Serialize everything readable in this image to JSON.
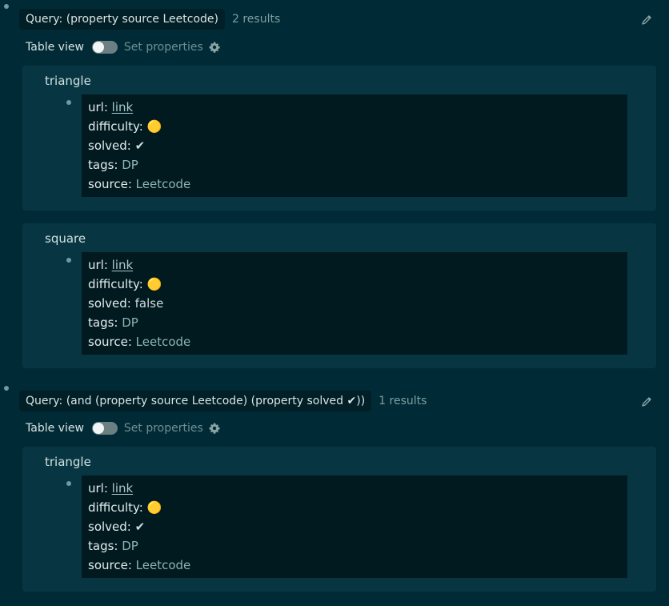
{
  "queries": [
    {
      "label": "Query: (property source Leetcode)",
      "count": "2 results",
      "table_view_label": "Table view",
      "set_props_label": "Set properties",
      "results": [
        {
          "title": "triangle",
          "props": [
            {
              "key": "url",
              "sep": ": ",
              "value": "link",
              "type": "link"
            },
            {
              "key": "difficulty",
              "sep": ": ",
              "value": "🟡",
              "type": "plain"
            },
            {
              "key": "solved",
              "sep": ": ",
              "value": "✔",
              "type": "plain"
            },
            {
              "key": "tags",
              "sep": ": ",
              "value": "DP",
              "type": "tag"
            },
            {
              "key": "source",
              "sep": ": ",
              "value": "Leetcode",
              "type": "tag"
            }
          ]
        },
        {
          "title": "square",
          "props": [
            {
              "key": "url",
              "sep": ": ",
              "value": "link",
              "type": "link"
            },
            {
              "key": "difficulty",
              "sep": ": ",
              "value": "🟡",
              "type": "plain"
            },
            {
              "key": "solved",
              "sep": ": ",
              "value": "false",
              "type": "plain"
            },
            {
              "key": "tags",
              "sep": ": ",
              "value": "DP",
              "type": "tag"
            },
            {
              "key": "source",
              "sep": ": ",
              "value": "Leetcode",
              "type": "tag"
            }
          ]
        }
      ]
    },
    {
      "label": "Query: (and (property source Leetcode) (property solved ✔))",
      "count": "1 results",
      "table_view_label": "Table view",
      "set_props_label": "Set properties",
      "results": [
        {
          "title": "triangle",
          "props": [
            {
              "key": "url",
              "sep": ": ",
              "value": "link",
              "type": "link"
            },
            {
              "key": "difficulty",
              "sep": ": ",
              "value": "🟡",
              "type": "plain"
            },
            {
              "key": "solved",
              "sep": ": ",
              "value": "✔",
              "type": "plain"
            },
            {
              "key": "tags",
              "sep": ": ",
              "value": "DP",
              "type": "tag"
            },
            {
              "key": "source",
              "sep": ": ",
              "value": "Leetcode",
              "type": "tag"
            }
          ]
        }
      ]
    }
  ]
}
